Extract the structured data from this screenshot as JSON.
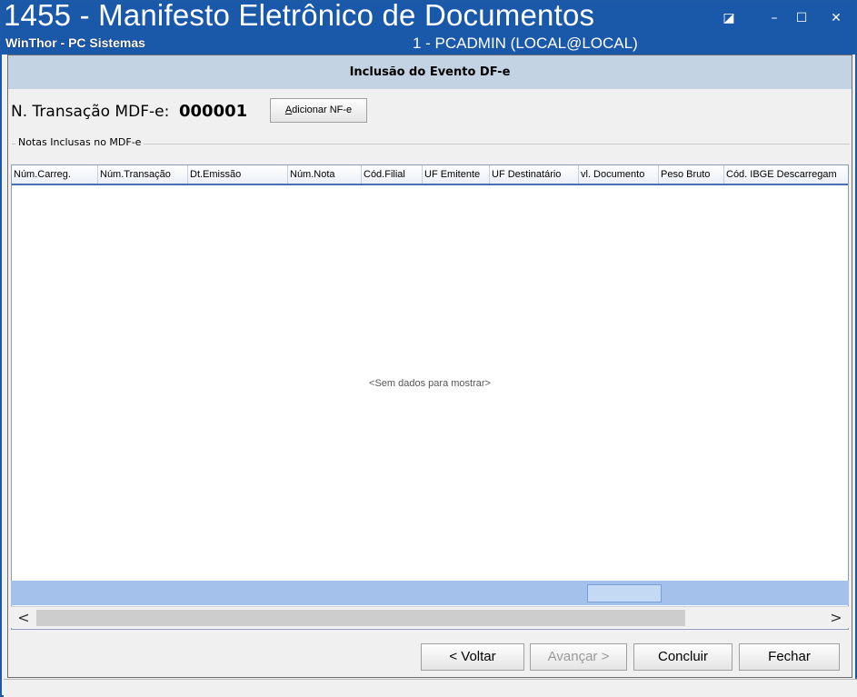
{
  "window": {
    "title": "1455 - Manifesto Eletrônico de Documentos",
    "app_name": "WinThor - PC Sistemas",
    "user_info": "1 - PCADMIN (LOCAL@LOCAL)",
    "restore_glyph": "◪",
    "minimize_glyph": "–",
    "maximize_glyph": "☐",
    "close_glyph": "✕"
  },
  "dialog": {
    "header": "Inclusão do Evento DF-e",
    "transaction_label": "N. Transação MDF-e:",
    "transaction_value": "000001",
    "add_nfe_button": "Adicionar NF-e",
    "group_label": "Notas Inclusas no MDF-e"
  },
  "grid": {
    "columns": [
      "Núm.Carreg.",
      "Núm.Transação",
      "Dt.Emissão",
      "Núm.Nota",
      "Cód.Filial",
      "UF Emitente",
      "UF Destinatário",
      "vl. Documento",
      "Peso Bruto",
      "Cód. IBGE Descarregam"
    ],
    "empty_message": "<Sem dados para mostrar>",
    "scroll_left_glyph": "<",
    "scroll_right_glyph": ">"
  },
  "buttons": {
    "back": "< Voltar",
    "next": "Avançar >",
    "finish": "Concluir",
    "close": "Fechar"
  },
  "colors": {
    "titlebar": "#1a58aa",
    "dialog_header": "#c3d3e3",
    "grid_footer": "#a4c1ec"
  }
}
